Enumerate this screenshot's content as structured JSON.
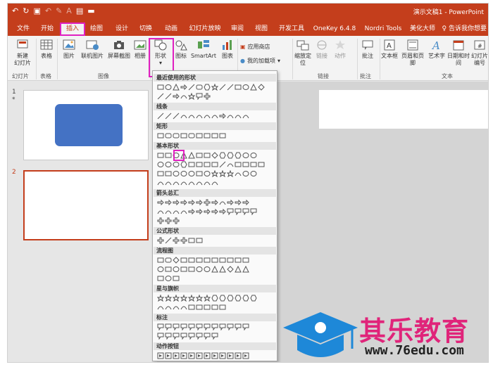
{
  "titlebar": {
    "qat": [
      "↶",
      "↻",
      "▣",
      "↶",
      "✎",
      "A",
      "▤",
      "▬"
    ],
    "doc_title": "演示文稿1 - PowerPoint"
  },
  "tabs": [
    "文件",
    "开始",
    "插入",
    "绘图",
    "设计",
    "切换",
    "动画",
    "幻灯片放映",
    "审阅",
    "视图",
    "开发工具",
    "OneKey 6.4.8",
    "Nordri Tools",
    "美化大师"
  ],
  "tell_me": "告诉我你想要",
  "ribbon": {
    "new_slide": "新建\n幻灯片",
    "table": "表格",
    "picture": "图片",
    "online_picture": "联机图片",
    "screenshot": "屏幕截图",
    "album": "相册",
    "shapes": "形状",
    "icons": "图标",
    "smartart": "SmartArt",
    "chart": "图表",
    "store": "应用商店",
    "my_addins": "我的加载项",
    "zoom": "缩放定\n位",
    "link": "链接",
    "action": "动作",
    "comment": "批注",
    "textbox": "文本框",
    "header_footer": "页眉和页脚",
    "wordart": "艺术字",
    "datetime": "日期和时间",
    "slide_number": "幻灯片\n编号",
    "groups": {
      "slides": "幻灯片",
      "tables": "表格",
      "images": "图像",
      "links": "链接",
      "comments": "批注",
      "text": "文本"
    }
  },
  "slides": [
    {
      "number": "1",
      "star": "*"
    },
    {
      "number": "2"
    }
  ],
  "shapes_menu": {
    "categories": [
      "最近使用的形状",
      "线条",
      "矩形",
      "基本形状",
      "箭头总汇",
      "公式形状",
      "流程图",
      "星与旗帜",
      "标注",
      "动作按钮"
    ]
  },
  "watermark": {
    "brand": "其乐教育",
    "url": "www.76edu.com"
  }
}
